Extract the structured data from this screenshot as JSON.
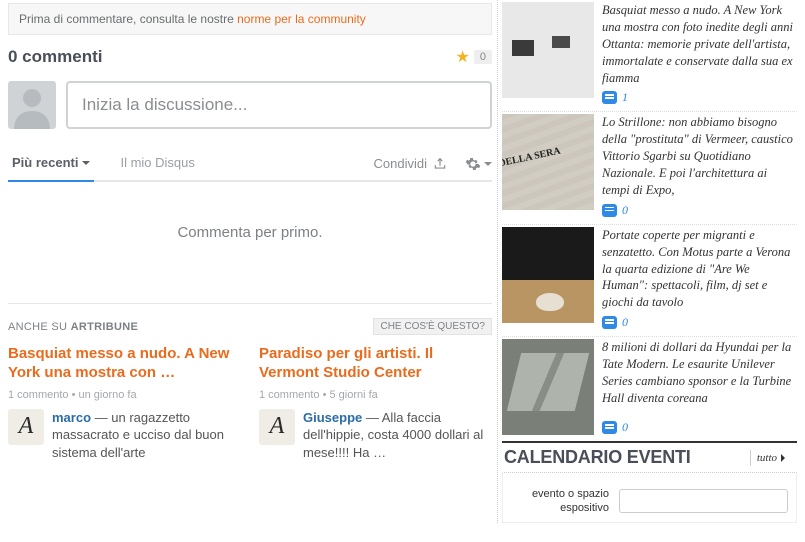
{
  "notice": {
    "prefix": "Prima di commentare, consulta le nostre ",
    "link": "norme per la community"
  },
  "comments_header": {
    "count_label": "0 commenti",
    "star_count": "0"
  },
  "compose": {
    "placeholder": "Inizia la discussione..."
  },
  "tabs": {
    "recent": "Più recenti",
    "mydisqus": "Il mio Disqus",
    "share": "Condividi"
  },
  "empty_state": "Commenta per primo.",
  "also": {
    "header_prefix": "ANCHE SU ",
    "header_brand": "ARTRIBUNE",
    "what_is_this": "CHE COS'È QUESTO?",
    "cards": [
      {
        "title": "Basquiat messo a nudo. A New York una mostra con …",
        "meta": "1 commento • un giorno fa",
        "user": "marco",
        "text": " — un ragazzetto massacrato e ucciso dal buon sistema dell'arte"
      },
      {
        "title": "Paradiso per gli artisti. Il Vermont Studio Center",
        "meta": "1 commento • 5 giorni fa",
        "user": "Giuseppe",
        "text": " — Alla faccia dell'hippie, costa 4000 dollari al mese!!!! Ha …"
      }
    ]
  },
  "sidebar": {
    "items": [
      {
        "title": "Basquiat messo a nudo. A New York una mostra con foto inedite degli anni Ottanta: memorie private dell'artista, immortalate e conservate dalla sua ex fiamma",
        "count": "1"
      },
      {
        "title": "Lo Strillone: non abbiamo bisogno della \"prostituta\" di Vermeer, caustico Vittorio Sgarbi su Quotidiano Nazionale. E poi l'architettura ai tempi di Expo,",
        "count": "0"
      },
      {
        "title": "Portate coperte per migranti e senzatetto. Con Motus parte a Verona la quarta edizione di \"Are We Human\": spettacoli, film, dj set e giochi da tavolo",
        "count": "0"
      },
      {
        "title": "8 milioni di dollari da Hyundai per la Tate Modern. Le esaurite Unilever Series cambiano sponsor e la Turbine Hall diventa coreana",
        "count": "0"
      }
    ]
  },
  "calendar": {
    "title": "CALENDARIO EVENTI",
    "tutto": "tutto",
    "label": "evento o spazio espositivo"
  }
}
